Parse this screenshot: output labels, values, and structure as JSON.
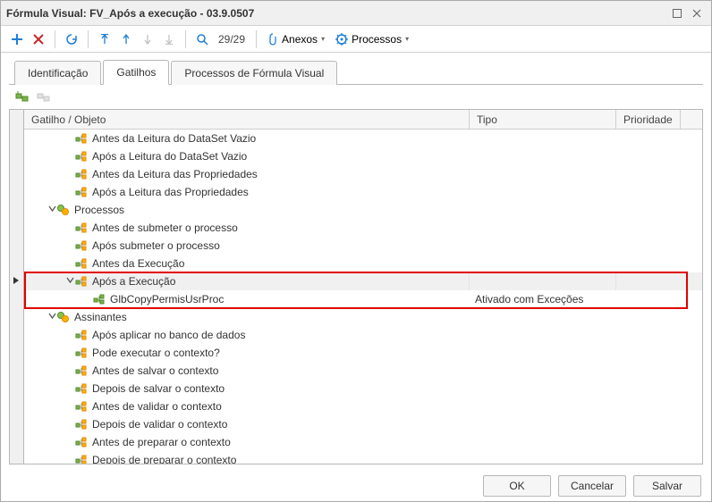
{
  "window": {
    "title": "Fórmula Visual: FV_Após a execução - 03.9.0507"
  },
  "toolbar": {
    "counter": "29/29",
    "anexos": "Anexos",
    "processos": "Processos"
  },
  "tabs": [
    "Identificação",
    "Gatilhos",
    "Processos de Fórmula Visual"
  ],
  "active_tab": 1,
  "columns": {
    "c1": "Gatilho / Objeto",
    "c2": "Tipo",
    "c3": "Prioridade"
  },
  "rows": [
    {
      "indent": 40,
      "icon": "leaf",
      "label": "Antes da Leitura do DataSet Vazio"
    },
    {
      "indent": 40,
      "icon": "leaf",
      "label": "Após a Leitura do DataSet Vazio"
    },
    {
      "indent": 40,
      "icon": "leaf",
      "label": "Antes da Leitura das Propriedades"
    },
    {
      "indent": 40,
      "icon": "leaf",
      "label": "Após a Leitura das Propriedades"
    },
    {
      "indent": 20,
      "icon": "folder",
      "label": "Processos",
      "toggle": "v"
    },
    {
      "indent": 40,
      "icon": "leaf",
      "label": "Antes de submeter o processo"
    },
    {
      "indent": 40,
      "icon": "leaf",
      "label": "Após submeter o processo"
    },
    {
      "indent": 40,
      "icon": "leaf",
      "label": "Antes da Execução"
    },
    {
      "indent": 40,
      "icon": "leaf",
      "label": "Após a Execução",
      "toggle": "v",
      "selected": true,
      "marker": true
    },
    {
      "indent": 60,
      "icon": "item",
      "label": "GlbCopyPermisUsrProc",
      "tipo": "Ativado com Exceções"
    },
    {
      "indent": 20,
      "icon": "folder",
      "label": "Assinantes",
      "toggle": "v"
    },
    {
      "indent": 40,
      "icon": "leaf",
      "label": "Após aplicar no banco de dados"
    },
    {
      "indent": 40,
      "icon": "leaf",
      "label": "Pode executar o contexto?"
    },
    {
      "indent": 40,
      "icon": "leaf",
      "label": "Antes de salvar o contexto"
    },
    {
      "indent": 40,
      "icon": "leaf",
      "label": "Depois de salvar o contexto"
    },
    {
      "indent": 40,
      "icon": "leaf",
      "label": "Antes de validar o contexto"
    },
    {
      "indent": 40,
      "icon": "leaf",
      "label": "Depois de validar o contexto"
    },
    {
      "indent": 40,
      "icon": "leaf",
      "label": "Antes de preparar o contexto"
    },
    {
      "indent": 40,
      "icon": "leaf",
      "label": "Depois de preparar o contexto"
    }
  ],
  "buttons": {
    "ok": "OK",
    "cancelar": "Cancelar",
    "salvar": "Salvar"
  },
  "colors": {
    "accent_add": "#1e7fd6",
    "accent_del": "#c62828",
    "highlight": "#e30000"
  },
  "highlight_rows": {
    "start": 8,
    "end": 9
  }
}
